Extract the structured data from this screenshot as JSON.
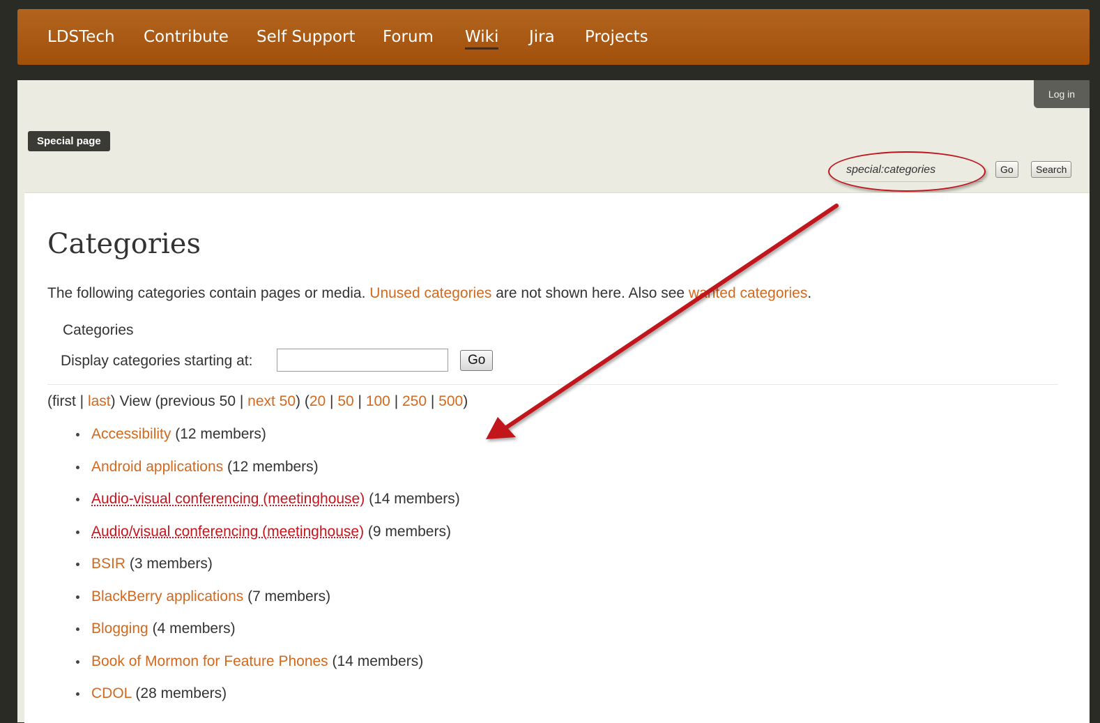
{
  "topnav": {
    "items": [
      {
        "label": "LDSTech",
        "active": false
      },
      {
        "label": "Contribute",
        "active": false
      },
      {
        "label": "Self Support",
        "active": false
      },
      {
        "label": "Forum",
        "active": false
      },
      {
        "label": "Wiki",
        "active": true
      },
      {
        "label": "Jira",
        "active": false
      },
      {
        "label": "Projects",
        "active": false
      }
    ]
  },
  "header": {
    "login_label": "Log in",
    "special_page_badge": "Special page",
    "search_value": "special:categories",
    "go_label": "Go",
    "search_label": "Search"
  },
  "main": {
    "title": "Categories",
    "intro": {
      "part1": "The following categories contain pages or media. ",
      "link1": "Unused categories",
      "part2": " are not shown here. Also see ",
      "link2": "wanted categories",
      "part3": "."
    },
    "form_legend": "Categories",
    "display_label": "Display categories starting at:",
    "display_value": "",
    "go_label": "Go",
    "pager": {
      "open1": "(first | ",
      "last": "last",
      "mid": ") View (previous 50 | ",
      "next50": "next 50",
      "mid2": ") (",
      "n20": "20",
      "n50": "50",
      "n100": "100",
      "n250": "250",
      "n500": "500",
      "sep": " | ",
      "close": ")"
    },
    "categories": [
      {
        "name": "Accessibility",
        "members": "(12 members)",
        "missing": false
      },
      {
        "name": "Android applications",
        "members": "(12 members)",
        "missing": false
      },
      {
        "name": "Audio-visual conferencing (meetinghouse)",
        "members": "(14 members)",
        "missing": true
      },
      {
        "name": "Audio/visual conferencing (meetinghouse)",
        "members": "(9 members)",
        "missing": true
      },
      {
        "name": "BSIR",
        "members": "(3 members)",
        "missing": false
      },
      {
        "name": "BlackBerry applications",
        "members": "(7 members)",
        "missing": false
      },
      {
        "name": "Blogging",
        "members": "(4 members)",
        "missing": false
      },
      {
        "name": "Book of Mormon for Feature Phones",
        "members": "(14 members)",
        "missing": false
      },
      {
        "name": "CDOL",
        "members": "(28 members)",
        "missing": false
      }
    ]
  },
  "colors": {
    "nav_orange": "#a95a14",
    "link_orange": "#d2691e",
    "missing_link_red": "#c4141c",
    "annotation_red": "#c0141c"
  }
}
